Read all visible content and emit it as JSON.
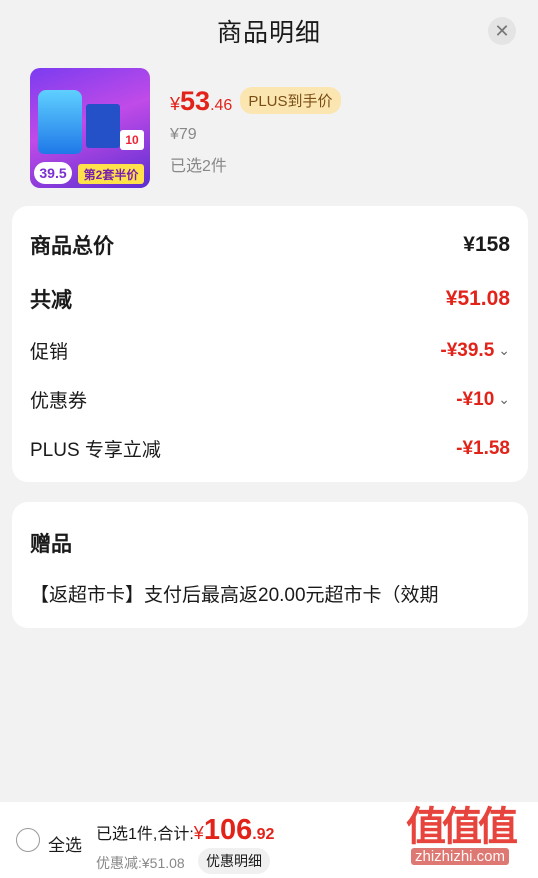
{
  "header": {
    "title": "商品明细",
    "close_icon": "close-icon"
  },
  "product": {
    "thumb": {
      "price": "39.5",
      "badge": "第2套半价",
      "tag": "10"
    },
    "price_currency": "¥",
    "price_integer": "53",
    "price_decimal": ".46",
    "plus_tag": "PLUS到手价",
    "original_price": "¥79",
    "selected": "已选2件"
  },
  "summary": {
    "total_label": "商品总价",
    "total_value": "¥158",
    "reduce_label": "共减",
    "reduce_value": "¥51.08",
    "promo_label": "促销",
    "promo_value": "-¥39.5",
    "coupon_label": "优惠券",
    "coupon_value": "-¥10",
    "plus_label": "PLUS 专享立减",
    "plus_value": "-¥1.58"
  },
  "gift": {
    "title": "赠品",
    "text": "【返超市卡】支付后最高返20.00元超市卡（效期"
  },
  "footer": {
    "select_all": "全选",
    "summary": "已选1件,合计:",
    "total_currency": "¥",
    "total_integer": "106",
    "total_decimal": ".92",
    "discount": "优惠减:¥51.08",
    "detail_button": "优惠明细"
  },
  "watermark": {
    "mark": "值值值",
    "text": "zhizhizhi.com"
  },
  "colors": {
    "accent": "#e2231a",
    "plus_bg": "#fbe6b2",
    "page_bg": "#f2f2f2"
  }
}
